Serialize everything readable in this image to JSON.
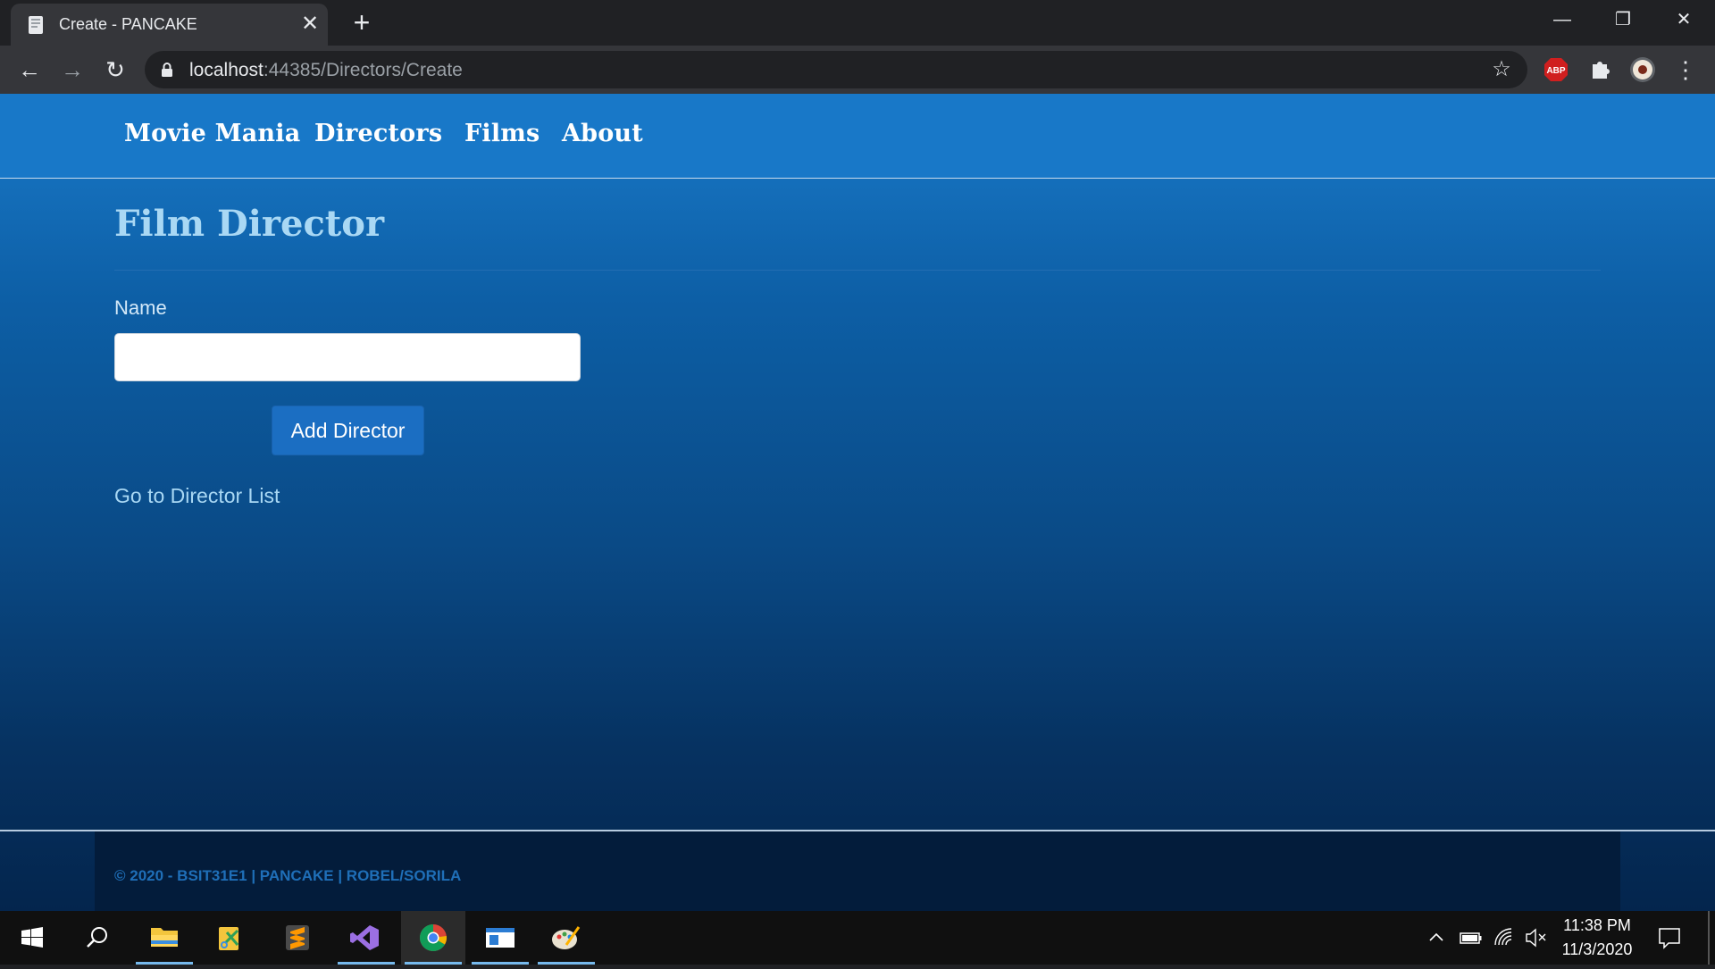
{
  "browser": {
    "tab_title": "Create - PANCAKE",
    "url_host": "localhost",
    "url_path": ":44385/Directors/Create",
    "close_symbol": "✕",
    "new_tab_symbol": "+",
    "minimize_symbol": "—",
    "restore_symbol": "❐",
    "window_close_symbol": "✕",
    "back_symbol": "←",
    "forward_symbol": "→",
    "reload_symbol": "↻",
    "star_symbol": "☆",
    "menu_symbol": "⋮",
    "extensions": [
      {
        "name": "adblock-plus-icon",
        "label": "ABP"
      },
      {
        "name": "puzzle-extensions-icon"
      },
      {
        "name": "profile-avatar-icon"
      }
    ]
  },
  "site": {
    "nav": [
      "Movie Mania",
      "Directors",
      "Films",
      "About"
    ],
    "page_title": "Film Director",
    "form": {
      "name_label": "Name",
      "name_value": "",
      "submit_label": "Add Director"
    },
    "back_link": "Go to Director List",
    "footer": "© 2020 - BSIT31E1 | PANCAKE | ROBEL/SORILA"
  },
  "taskbar": {
    "apps": [
      {
        "name": "windows-start-icon"
      },
      {
        "name": "search-icon"
      },
      {
        "name": "file-explorer-icon"
      },
      {
        "name": "snipping-tool-icon"
      },
      {
        "name": "sublime-text-icon"
      },
      {
        "name": "visual-studio-icon"
      },
      {
        "name": "chrome-icon",
        "active": true
      },
      {
        "name": "app-window-icon"
      },
      {
        "name": "paint-icon"
      }
    ],
    "time": "11:38 PM",
    "date": "11/3/2020"
  },
  "colors": {
    "nav_bar": "#1878c8",
    "title_text": "#a9d8f4",
    "button": "#1b6ec2",
    "footer_bg": "#031c3b",
    "footer_text": "#1f6fb8"
  }
}
